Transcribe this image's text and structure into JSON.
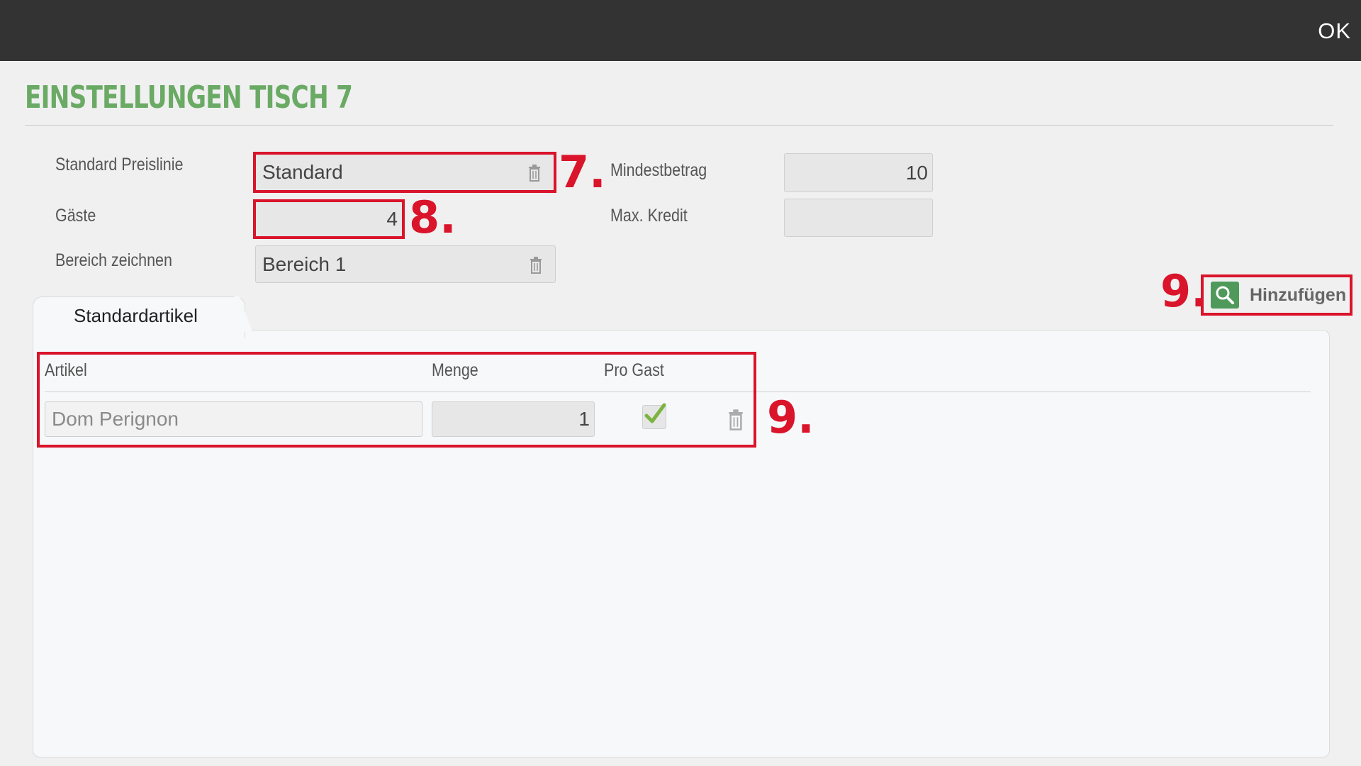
{
  "topbar": {
    "ok_label": "OK"
  },
  "page": {
    "title": "EINSTELLUNGEN TISCH  7"
  },
  "form": {
    "preislinie_label": "Standard Preislinie",
    "preislinie_value": "Standard",
    "gaeste_label": "Gäste",
    "gaeste_value": "4",
    "bereich_label": "Bereich zeichnen",
    "bereich_value": "Bereich 1",
    "mindestbetrag_label": "Mindestbetrag",
    "mindestbetrag_value": "10",
    "kredit_label": "Max. Kredit",
    "kredit_value": ""
  },
  "tabs": [
    {
      "label": "Standardartikel"
    }
  ],
  "add_button": {
    "label": "Hinzufügen",
    "icon": "search-icon"
  },
  "table": {
    "columns": [
      "Artikel",
      "Menge",
      "Pro Gast"
    ],
    "rows": [
      {
        "artikel": "Dom Perignon",
        "menge": "1",
        "pro_gast": true
      }
    ]
  },
  "annotations": [
    "7.",
    "8.",
    "9.",
    "9."
  ],
  "colors": {
    "title": "#6aaa64",
    "topbar": "#333333",
    "annotation": "#d9142b",
    "check": "#7cb342",
    "add_icon": "#4f9a5a"
  }
}
